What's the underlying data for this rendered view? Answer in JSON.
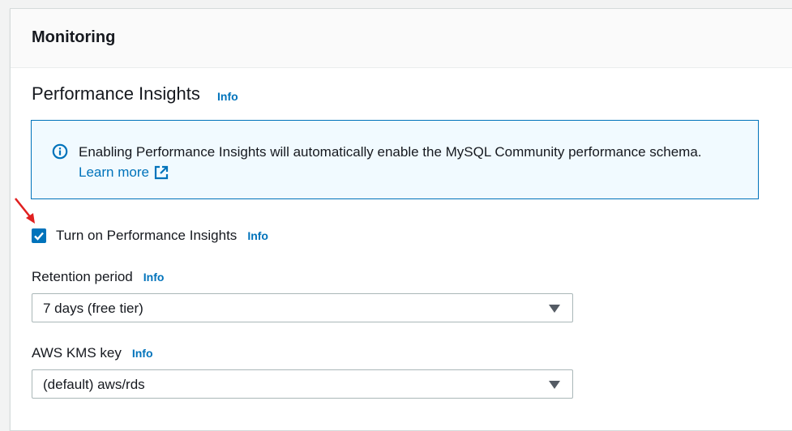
{
  "panel": {
    "title": "Monitoring"
  },
  "performance_insights": {
    "title": "Performance Insights",
    "info_label": "Info",
    "alert": {
      "icon": "info-circle-icon",
      "message": "Enabling Performance Insights will automatically enable the MySQL Community performance schema.",
      "learn_more_label": "Learn more",
      "learn_more_icon": "external-link-icon"
    },
    "toggle": {
      "label": "Turn on Performance Insights",
      "info_label": "Info",
      "checked": true
    },
    "retention": {
      "label": "Retention period",
      "info_label": "Info",
      "value": "7 days (free tier)"
    },
    "kms_key": {
      "label": "AWS KMS key",
      "info_label": "Info",
      "value": "(default) aws/rds"
    }
  },
  "colors": {
    "link": "#0073bb",
    "alert_bg": "#f1faff",
    "alert_border": "#0073bb",
    "checkbox": "#0073bb",
    "annotation_arrow": "#e02020"
  }
}
